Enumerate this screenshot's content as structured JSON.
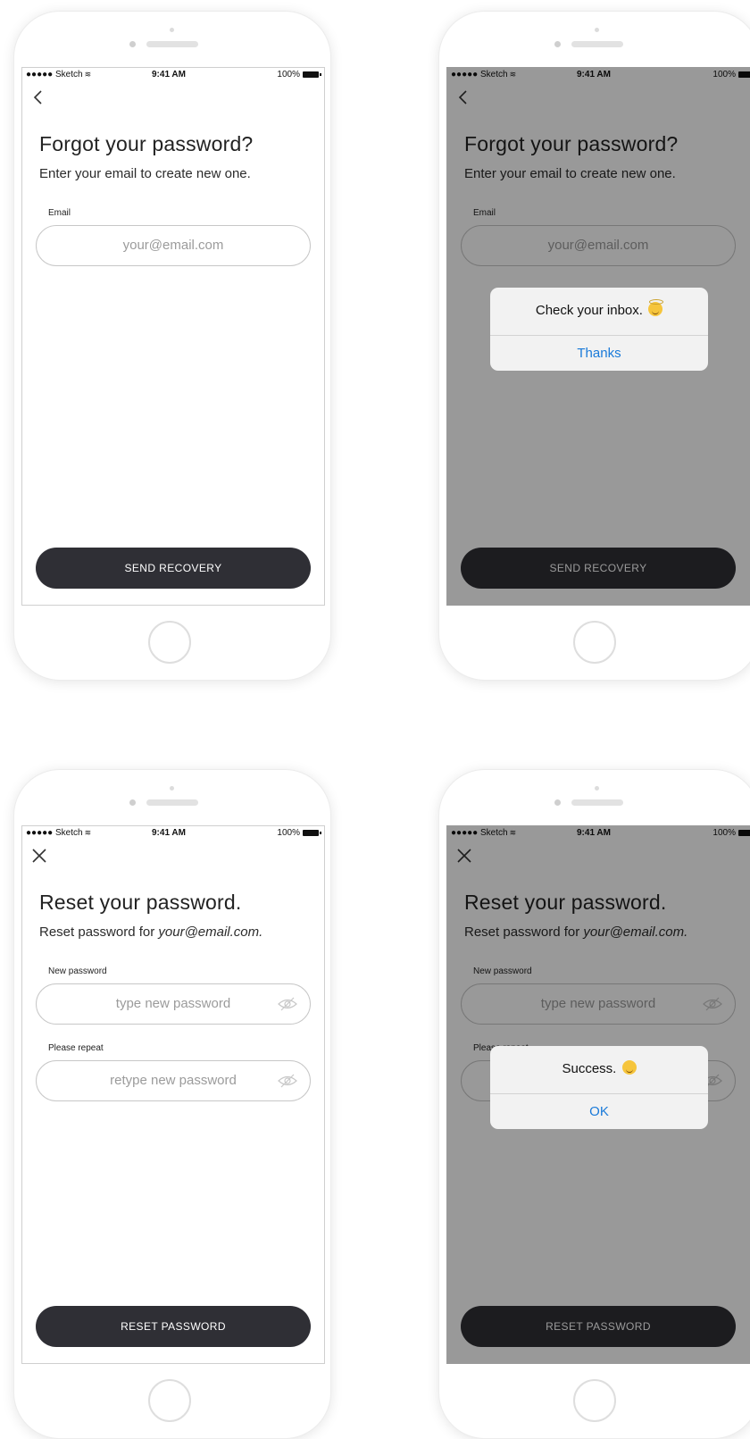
{
  "status_bar": {
    "carrier": "●●●●● Sketch",
    "time": "9:41 AM",
    "battery": "100%"
  },
  "forgot": {
    "title": "Forgot your password?",
    "subtitle": "Enter your email to create new one.",
    "email_label": "Email",
    "email_placeholder": "your@email.com",
    "button_label": "SEND RECOVERY"
  },
  "forgot_alert": {
    "message": "Check your inbox.",
    "button": "Thanks"
  },
  "reset": {
    "title": "Reset your password.",
    "subtitle_prefix": "Reset password for ",
    "subtitle_email": "your@email.com.",
    "new_label": "New password",
    "new_placeholder": "type new password",
    "repeat_label": "Please repeat",
    "repeat_placeholder": "retype new password",
    "button_label": "RESET PASSWORD"
  },
  "reset_alert": {
    "message": "Success.",
    "button": "OK"
  },
  "icons": {
    "back": "chevron-left-icon",
    "close": "close-icon",
    "eye": "eye-slash-icon"
  },
  "colors": {
    "button_dark": "#2f2f35",
    "alert_link": "#1a7ad9",
    "overlay": "rgba(0,0,0,0.40)"
  }
}
